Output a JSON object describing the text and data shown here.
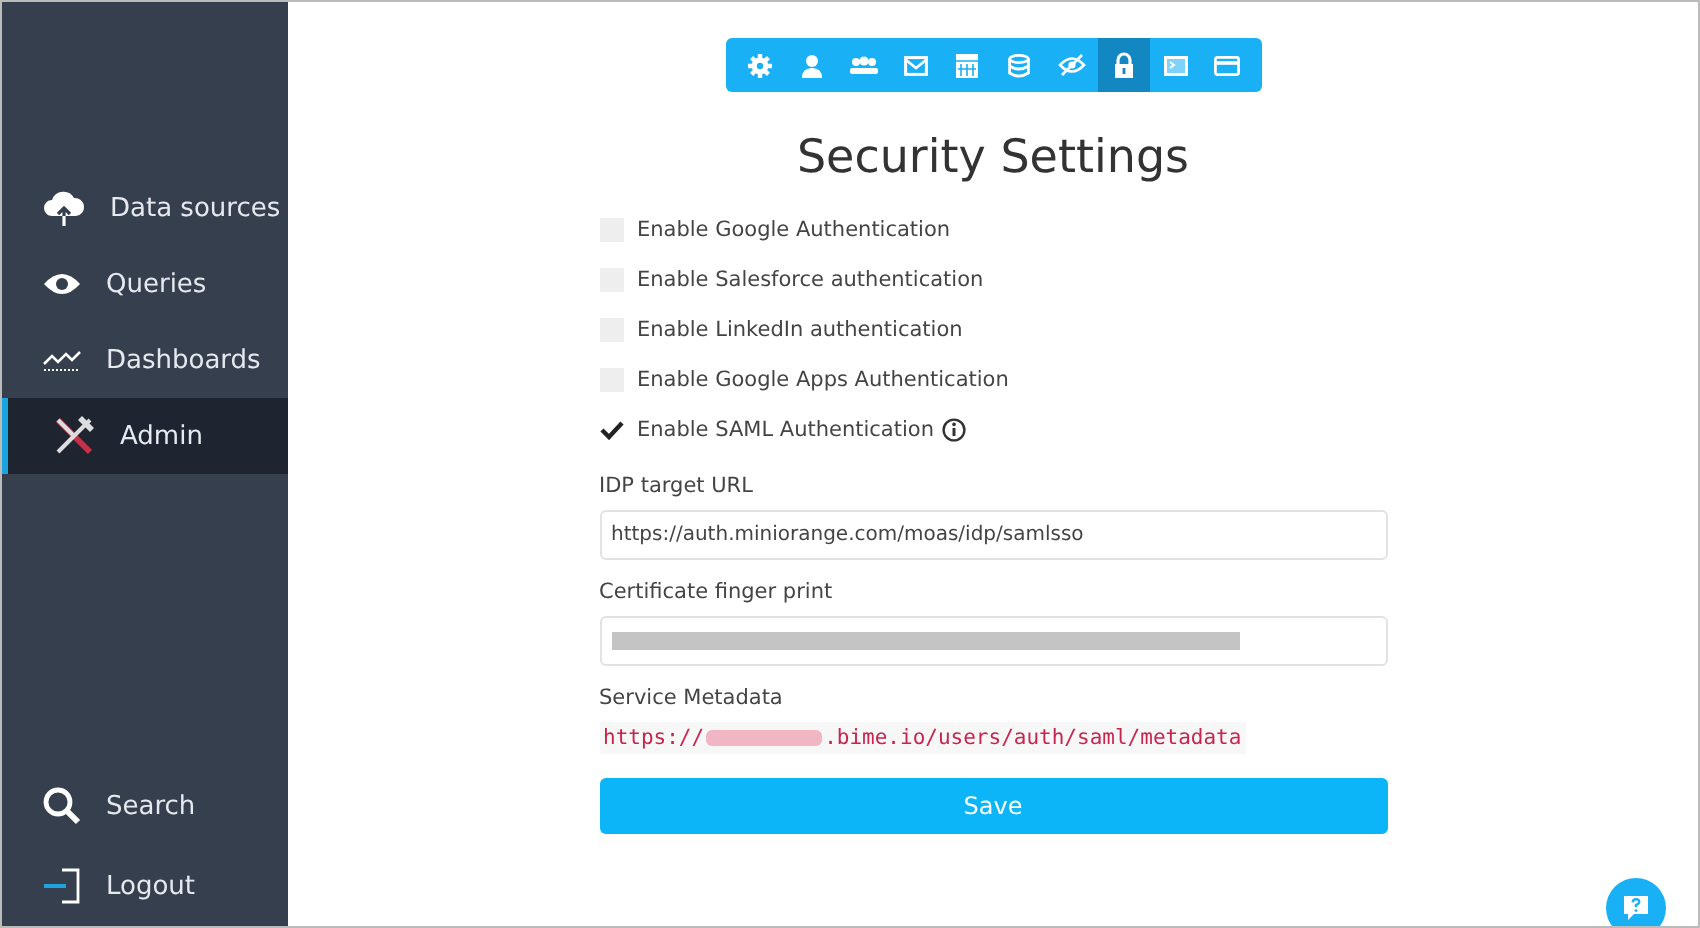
{
  "sidebar": {
    "items": [
      {
        "kind": "cloud",
        "label": "Data sources",
        "selected": false
      },
      {
        "kind": "eye",
        "label": "Queries",
        "selected": false
      },
      {
        "kind": "chart",
        "label": "Dashboards",
        "selected": false
      },
      {
        "kind": "tools",
        "label": "Admin",
        "selected": true
      }
    ],
    "bottom_items": [
      {
        "kind": "search",
        "label": "Search"
      },
      {
        "kind": "logout",
        "label": "Logout"
      }
    ]
  },
  "toolbar": [
    {
      "kind": "gear",
      "selected": false
    },
    {
      "kind": "user",
      "selected": false
    },
    {
      "kind": "users",
      "selected": false
    },
    {
      "kind": "mail",
      "selected": false
    },
    {
      "kind": "calendar",
      "selected": false
    },
    {
      "kind": "database",
      "selected": false
    },
    {
      "kind": "eye-off",
      "selected": false
    },
    {
      "kind": "lock",
      "selected": true
    },
    {
      "kind": "terminal",
      "selected": false
    },
    {
      "kind": "card",
      "selected": false
    }
  ],
  "title": "Security Settings",
  "options": [
    {
      "label": "Enable Google Authentication",
      "checked": false,
      "info": false
    },
    {
      "label": "Enable Salesforce authentication",
      "checked": false,
      "info": false
    },
    {
      "label": "Enable LinkedIn authentication",
      "checked": false,
      "info": false
    },
    {
      "label": "Enable Google Apps Authentication",
      "checked": false,
      "info": false
    },
    {
      "label": "Enable SAML Authentication",
      "checked": true,
      "info": true
    }
  ],
  "idp": {
    "label": "IDP target URL",
    "value": "https://auth.miniorange.com/moas/idp/samlsso"
  },
  "fingerprint": {
    "label": "Certificate finger print"
  },
  "metadata": {
    "label": "Service Metadata",
    "prefix": "https://",
    "suffix": ".bime.io/users/auth/saml/metadata"
  },
  "save": "Save"
}
